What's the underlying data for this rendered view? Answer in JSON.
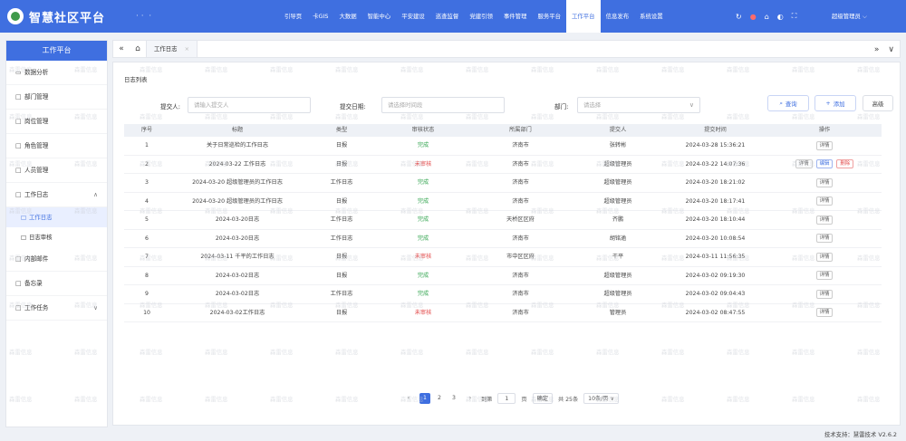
{
  "app": {
    "title": "智慧社区平台"
  },
  "top_nav": {
    "items": [
      "引导页",
      "卡GIS",
      "大数据",
      "智能中心",
      "平安建设",
      "巡查监督",
      "党建引领",
      "事件管理",
      "服务平台",
      "工作平台",
      "信息发布",
      "系统设置"
    ],
    "active_index": 9,
    "user": "超级管理员"
  },
  "sidebar": {
    "header": "工作平台",
    "items": [
      {
        "label": "数据分析",
        "icon": "chat-icon"
      },
      {
        "label": "部门管理",
        "icon": "folder-icon"
      },
      {
        "label": "岗位管理",
        "icon": "folder-icon"
      },
      {
        "label": "角色管理",
        "icon": "folder-icon"
      },
      {
        "label": "人员管理",
        "icon": "folder-icon"
      },
      {
        "label": "工作日志",
        "icon": "folder-icon",
        "expanded": true,
        "children": [
          {
            "label": "工作日志",
            "active": true
          },
          {
            "label": "日志审核"
          }
        ]
      },
      {
        "label": "内部邮件",
        "icon": "folder-icon"
      },
      {
        "label": "备忘录",
        "icon": "folder-icon"
      },
      {
        "label": "工作任务",
        "icon": "folder-icon",
        "collapsed": true
      }
    ]
  },
  "tabs": [
    {
      "label": "工作日志"
    }
  ],
  "panel": {
    "title": "日志列表",
    "filters": {
      "submitter_label": "提交人:",
      "submitter_placeholder": "请输入提交人",
      "date_label": "提交日期:",
      "date_placeholder": "请选择时间段",
      "dept_label": "部门:",
      "dept_placeholder": "请选择"
    },
    "buttons": {
      "search": "查询",
      "add": "添加",
      "advanced": "高级"
    }
  },
  "table": {
    "columns": [
      "序号",
      "标题",
      "类型",
      "审核状态",
      "所属部门",
      "提交人",
      "提交时间",
      "操作"
    ],
    "rows": [
      {
        "no": "1",
        "title": "关于日常巡检的工作日志",
        "type": "日报",
        "status": "完成",
        "status_kind": "done",
        "dept": "济南市",
        "submitter": "张转彬",
        "time": "2024-03-28 15:36:21",
        "ops": [
          "详情"
        ]
      },
      {
        "no": "2",
        "title": "2024-03-22 工作日志",
        "type": "日报",
        "status": "未审核",
        "status_kind": "pending",
        "dept": "济南市",
        "submitter": "超级管理员",
        "time": "2024-03-22 14:07:36",
        "ops": [
          "详情",
          "编辑",
          "删除"
        ]
      },
      {
        "no": "3",
        "title": "2024-03-20 超级管理员的工作日志",
        "type": "工作日志",
        "status": "完成",
        "status_kind": "done",
        "dept": "济南市",
        "submitter": "超级管理员",
        "time": "2024-03-20 18:21:02",
        "ops": [
          "详情"
        ]
      },
      {
        "no": "4",
        "title": "2024-03-20 超级管理员的工作日志",
        "type": "日报",
        "status": "完成",
        "status_kind": "done",
        "dept": "济南市",
        "submitter": "超级管理员",
        "time": "2024-03-20 18:17:41",
        "ops": [
          "详情"
        ]
      },
      {
        "no": "5",
        "title": "2024-03-20日志",
        "type": "工作日志",
        "status": "完成",
        "status_kind": "done",
        "dept": "天桥区区府",
        "submitter": "齐鹏",
        "time": "2024-03-20 18:10:44",
        "ops": [
          "详情"
        ]
      },
      {
        "no": "6",
        "title": "2024-03-20日志",
        "type": "工作日志",
        "status": "完成",
        "status_kind": "done",
        "dept": "济南市",
        "submitter": "胡铭逾",
        "time": "2024-03-20 10:08:54",
        "ops": [
          "详情"
        ]
      },
      {
        "no": "7",
        "title": "2024-03-11 千平的工作日志",
        "type": "日报",
        "status": "未审核",
        "status_kind": "pending",
        "dept": "市中区区府",
        "submitter": "干平",
        "time": "2024-03-11 11:56:35",
        "ops": [
          "详情"
        ]
      },
      {
        "no": "8",
        "title": "2024-03-02日志",
        "type": "日报",
        "status": "完成",
        "status_kind": "done",
        "dept": "济南市",
        "submitter": "超级管理员",
        "time": "2024-03-02 09:19:30",
        "ops": [
          "详情"
        ]
      },
      {
        "no": "9",
        "title": "2024-03-02日志",
        "type": "工作日志",
        "status": "完成",
        "status_kind": "done",
        "dept": "济南市",
        "submitter": "超级管理员",
        "time": "2024-03-02 09:04:43",
        "ops": [
          "详情"
        ]
      },
      {
        "no": "10",
        "title": "2024-03-02工作日志",
        "type": "日报",
        "status": "未审核",
        "status_kind": "pending",
        "dept": "济南市",
        "submitter": "管理员",
        "time": "2024-03-02 08:47:55",
        "ops": [
          "详情"
        ]
      }
    ]
  },
  "pagination": {
    "pages": [
      "1",
      "2",
      "3"
    ],
    "current": "1",
    "goto_label": "到第",
    "goto_value": "1",
    "page_unit": "页",
    "confirm": "确定",
    "total": "共 25条",
    "page_size": "10条/页"
  },
  "watermark": "森雷信息",
  "footer": "技术支持：慧雷技术 V2.6.2",
  "colors": {
    "primary": "#3f6fe0",
    "done": "#3aa856",
    "pending": "#e34d4d"
  }
}
